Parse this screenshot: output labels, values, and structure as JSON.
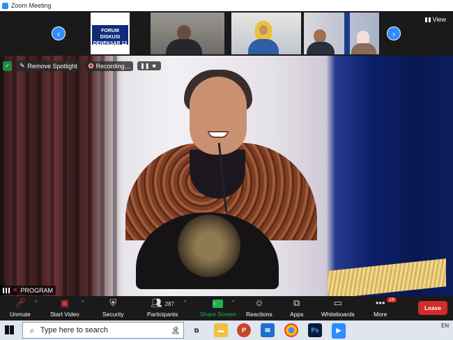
{
  "window": {
    "title": "Zoom Meeting"
  },
  "gallery": {
    "banner_text_1": "FORUM DISKUSI",
    "banner_text_2": "DENPASAR 12",
    "view_label": "View",
    "prev_icon": "chevron-left-icon",
    "next_icon": "chevron-right-icon"
  },
  "spotlight": {
    "remove_label": "Remove Spotlight",
    "recording_label": "Recording...",
    "pause_symbol": "❚❚",
    "stop_symbol": "■"
  },
  "speaker": {
    "name_label": "PROGRAM"
  },
  "toolbar": {
    "unmute": "Unmute",
    "start_video": "Start Video",
    "security": "Security",
    "participants": "Participants",
    "participants_count": "287",
    "share_screen": "Share Screen",
    "reactions": "Reactions",
    "apps": "Apps",
    "whiteboards": "Whiteboards",
    "more": "More",
    "more_badge": "19",
    "leave": "Leave"
  },
  "taskbar": {
    "search_placeholder": "Type here to search",
    "lang": "EN",
    "ps_label": "Ps"
  },
  "colors": {
    "zoom_blue": "#2d8cff",
    "leave_red": "#d42a2a",
    "share_green": "#21b24b"
  }
}
